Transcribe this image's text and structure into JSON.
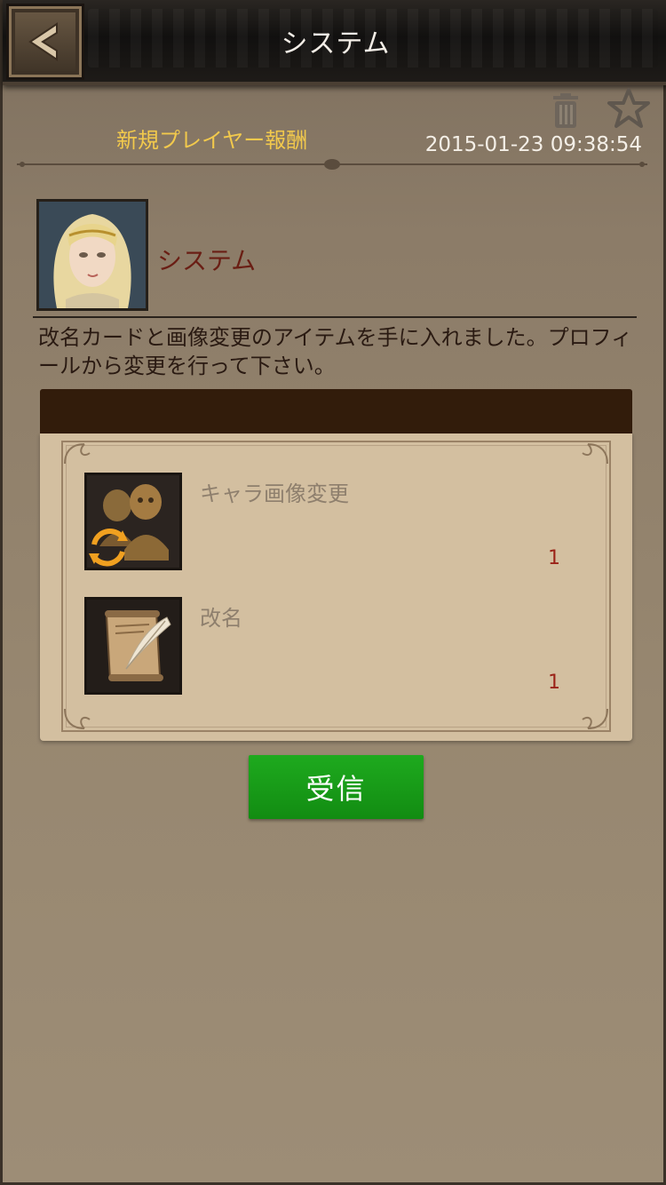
{
  "header": {
    "title": "システム",
    "back_icon": "chevron-left-icon"
  },
  "mail": {
    "subject": "新規プレイヤー報酬",
    "timestamp": "2015-01-23  09:38:54",
    "sender": "システム",
    "body": "改名カードと画像変更のアイテムを手に入れました。プロフィールから変更を行って下さい。",
    "icons": {
      "delete": "trash-icon",
      "favorite": "star-icon"
    }
  },
  "attachments": [
    {
      "name": "キャラ画像変更",
      "qty": "1",
      "icon": "character-image-change-icon"
    },
    {
      "name": "改名",
      "qty": "1",
      "icon": "rename-scroll-icon"
    }
  ],
  "actions": {
    "receive_label": "受信"
  },
  "colors": {
    "subject": "#f2c94c",
    "sender": "#6a1e14",
    "qty": "#9b2318",
    "button": "#18a018"
  }
}
